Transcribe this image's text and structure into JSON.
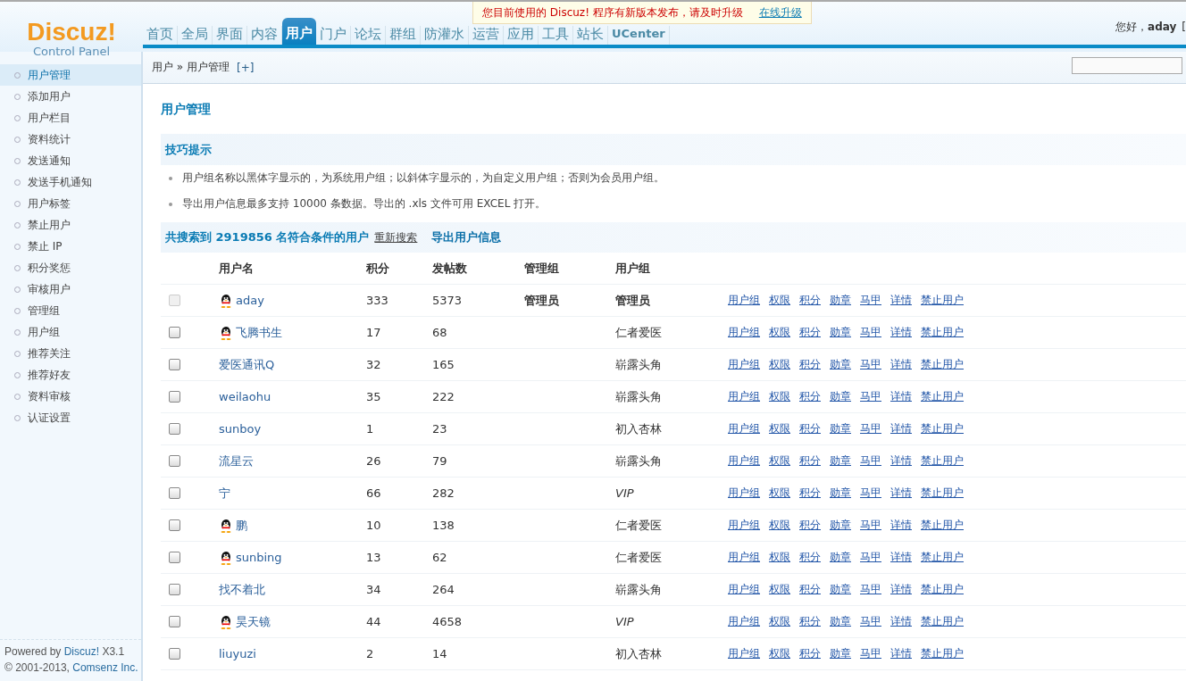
{
  "logo": {
    "name": "Discuz!",
    "subtitle": "Control Panel"
  },
  "nav": [
    {
      "label": "首页",
      "selected": false
    },
    {
      "label": "全局",
      "selected": false
    },
    {
      "label": "界面",
      "selected": false
    },
    {
      "label": "内容",
      "selected": false
    },
    {
      "label": "用户",
      "selected": true
    },
    {
      "label": "门户",
      "selected": false
    },
    {
      "label": "论坛",
      "selected": false
    },
    {
      "label": "群组",
      "selected": false
    },
    {
      "label": "防灌水",
      "selected": false
    },
    {
      "label": "运营",
      "selected": false
    },
    {
      "label": "应用",
      "selected": false
    },
    {
      "label": "工具",
      "selected": false
    },
    {
      "label": "站长",
      "selected": false
    },
    {
      "label": "UCenter",
      "selected": false
    }
  ],
  "notice": {
    "text": "您目前使用的 Discuz! 程序有新版本发布，请及时升级",
    "link": "在线升级"
  },
  "user": {
    "greeting": "您好，",
    "name": "aday",
    "bracket": "["
  },
  "breadcrumb": {
    "section": "用户",
    "separator": "»",
    "page": "用户管理",
    "add": "[+]"
  },
  "sidebar": [
    {
      "label": "用户管理",
      "selected": true
    },
    {
      "label": "添加用户",
      "selected": false
    },
    {
      "label": "用户栏目",
      "selected": false
    },
    {
      "label": "资料统计",
      "selected": false
    },
    {
      "label": "发送通知",
      "selected": false
    },
    {
      "label": "发送手机通知",
      "selected": false
    },
    {
      "label": "用户标签",
      "selected": false
    },
    {
      "label": "禁止用户",
      "selected": false
    },
    {
      "label": "禁止 IP",
      "selected": false
    },
    {
      "label": "积分奖惩",
      "selected": false
    },
    {
      "label": "审核用户",
      "selected": false
    },
    {
      "label": "管理组",
      "selected": false
    },
    {
      "label": "用户组",
      "selected": false
    },
    {
      "label": "推荐关注",
      "selected": false
    },
    {
      "label": "推荐好友",
      "selected": false
    },
    {
      "label": "资料审核",
      "selected": false
    },
    {
      "label": "认证设置",
      "selected": false
    }
  ],
  "footer": {
    "prefix": "Powered by",
    "product": "Discuz!",
    "version": "X3.1",
    "copyright": "© 2001-2013,",
    "company": "Comsenz Inc."
  },
  "title": "用户管理",
  "tips": {
    "title": "技巧提示",
    "items": [
      "用户组名称以黑体字显示的，为系统用户组；以斜体字显示的，为自定义用户组；否则为会员用户组。",
      "导出用户信息最多支持 10000 条数据。导出的 .xls 文件可用 EXCEL 打开。"
    ]
  },
  "result": {
    "summary": "共搜索到 2919856 名符合条件的用户",
    "research": "重新搜索",
    "export": "导出用户信息"
  },
  "columns": [
    "用户名",
    "积分",
    "发帖数",
    "管理组",
    "用户组"
  ],
  "rows": [
    {
      "checkbox_disabled": true,
      "qq": true,
      "name": "aday",
      "credits": "333",
      "posts": "5373",
      "admin_group": "管理员",
      "user_group": "管理员",
      "group_bold": true,
      "group_italic": false,
      "actions": [
        "用户组",
        "权限",
        "积分",
        "勋章",
        "马甲",
        "详情",
        "禁止用户"
      ]
    },
    {
      "checkbox_disabled": false,
      "qq": true,
      "name": "飞腾书生",
      "credits": "17",
      "posts": "68",
      "user_group": "仁者爱医",
      "group_bold": false,
      "group_italic": false,
      "actions": [
        "用户组",
        "权限",
        "积分",
        "勋章",
        "马甲",
        "详情",
        "禁止用户"
      ]
    },
    {
      "checkbox_disabled": false,
      "qq": false,
      "name": "爱医通讯Q",
      "credits": "32",
      "posts": "165",
      "user_group": "崭露头角",
      "group_bold": false,
      "group_italic": false,
      "actions": [
        "用户组",
        "权限",
        "积分",
        "勋章",
        "马甲",
        "详情",
        "禁止用户"
      ]
    },
    {
      "checkbox_disabled": false,
      "qq": false,
      "name": "weilaohu",
      "credits": "35",
      "posts": "222",
      "user_group": "崭露头角",
      "group_bold": false,
      "group_italic": false,
      "actions": [
        "用户组",
        "权限",
        "积分",
        "勋章",
        "马甲",
        "详情",
        "禁止用户"
      ]
    },
    {
      "checkbox_disabled": false,
      "qq": false,
      "name": "sunboy",
      "credits": "1",
      "posts": "23",
      "user_group": "初入杏林",
      "group_bold": false,
      "group_italic": false,
      "actions": [
        "用户组",
        "权限",
        "积分",
        "勋章",
        "马甲",
        "详情",
        "禁止用户"
      ]
    },
    {
      "checkbox_disabled": false,
      "qq": false,
      "name": "流星云",
      "credits": "26",
      "posts": "79",
      "user_group": "崭露头角",
      "group_bold": false,
      "group_italic": false,
      "actions": [
        "用户组",
        "权限",
        "积分",
        "勋章",
        "马甲",
        "详情",
        "禁止用户"
      ]
    },
    {
      "checkbox_disabled": false,
      "qq": false,
      "name": "宁",
      "credits": "66",
      "posts": "282",
      "user_group": "VIP",
      "group_bold": false,
      "group_italic": true,
      "actions": [
        "用户组",
        "权限",
        "积分",
        "勋章",
        "马甲",
        "详情",
        "禁止用户"
      ]
    },
    {
      "checkbox_disabled": false,
      "qq": true,
      "name": "鹏",
      "credits": "10",
      "posts": "138",
      "user_group": "仁者爱医",
      "group_bold": false,
      "group_italic": false,
      "actions": [
        "用户组",
        "权限",
        "积分",
        "勋章",
        "马甲",
        "详情",
        "禁止用户"
      ]
    },
    {
      "checkbox_disabled": false,
      "qq": true,
      "name": "sunbing",
      "credits": "13",
      "posts": "62",
      "user_group": "仁者爱医",
      "group_bold": false,
      "group_italic": false,
      "actions": [
        "用户组",
        "权限",
        "积分",
        "勋章",
        "马甲",
        "详情",
        "禁止用户"
      ]
    },
    {
      "checkbox_disabled": false,
      "qq": false,
      "name": "找不着北",
      "credits": "34",
      "posts": "264",
      "user_group": "崭露头角",
      "group_bold": false,
      "group_italic": false,
      "actions": [
        "用户组",
        "权限",
        "积分",
        "勋章",
        "马甲",
        "详情",
        "禁止用户"
      ]
    },
    {
      "checkbox_disabled": false,
      "qq": true,
      "name": "昊天镜",
      "credits": "44",
      "posts": "4658",
      "user_group": "VIP",
      "group_bold": false,
      "group_italic": true,
      "actions": [
        "用户组",
        "权限",
        "积分",
        "勋章",
        "马甲",
        "详情",
        "禁止用户"
      ]
    },
    {
      "checkbox_disabled": false,
      "qq": false,
      "name": "liuyuzi",
      "credits": "2",
      "posts": "14",
      "user_group": "初入杏林",
      "group_bold": false,
      "group_italic": false,
      "actions": [
        "用户组",
        "权限",
        "积分",
        "勋章",
        "马甲",
        "详情",
        "禁止用户"
      ]
    }
  ]
}
